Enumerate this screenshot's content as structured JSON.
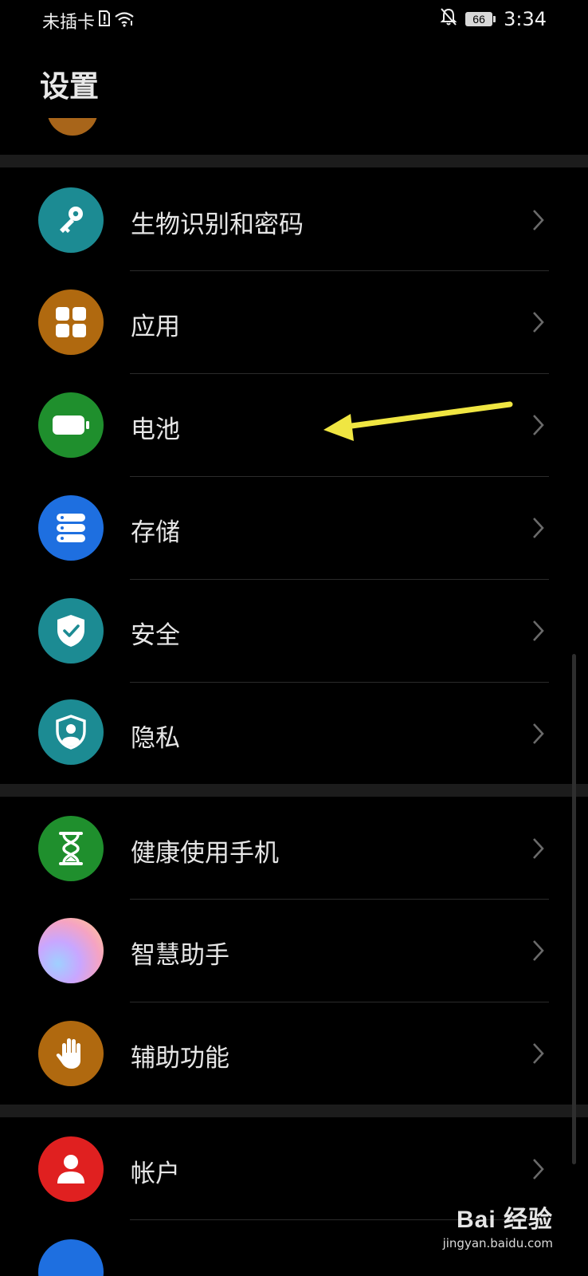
{
  "status_bar": {
    "carrier": "未插卡",
    "battery_level": "66",
    "time": "3:34"
  },
  "header": {
    "title": "设置"
  },
  "settings_items": [
    {
      "label": "生物识别和密码",
      "icon": "key-icon",
      "color": "#1c8b93"
    },
    {
      "label": "应用",
      "icon": "apps-grid-icon",
      "color": "#b0690f"
    },
    {
      "label": "电池",
      "icon": "battery-icon",
      "color": "#1f8f2d"
    },
    {
      "label": "存储",
      "icon": "storage-icon",
      "color": "#1e6fe0"
    },
    {
      "label": "安全",
      "icon": "shield-check-icon",
      "color": "#1c8b93"
    },
    {
      "label": "隐私",
      "icon": "privacy-shield-icon",
      "color": "#1c8b93"
    },
    {
      "label": "健康使用手机",
      "icon": "hourglass-icon",
      "color": "#1f8f2d"
    },
    {
      "label": "智慧助手",
      "icon": "assistant-orb-icon",
      "color": "#e7a6d0"
    },
    {
      "label": "辅助功能",
      "icon": "hand-icon",
      "color": "#b0690f"
    },
    {
      "label": "帐户",
      "icon": "account-person-icon",
      "color": "#e02020"
    }
  ],
  "annotation": {
    "arrow_color": "#f0e642"
  },
  "watermark": {
    "logo": "Bai 经验",
    "url": "jingyan.baidu.com"
  }
}
